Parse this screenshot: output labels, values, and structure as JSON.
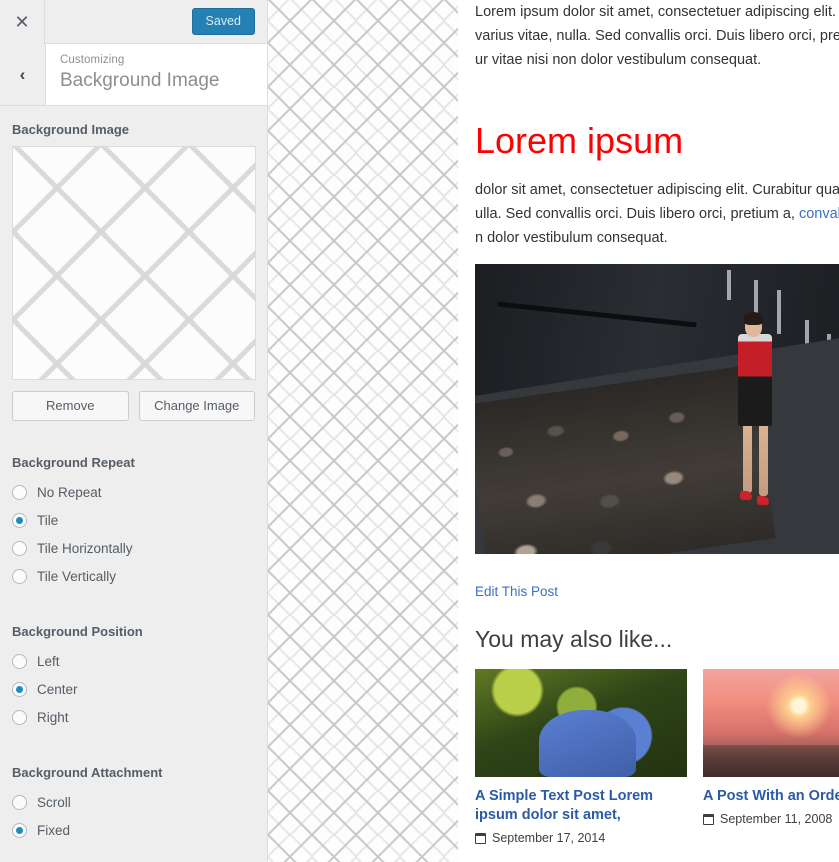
{
  "customizer": {
    "close_label": "✕",
    "saved_button": "Saved",
    "back_label": "‹",
    "subtitle": "Customizing",
    "title": "Background Image",
    "controls": {
      "background_image_label": "Background Image",
      "remove_button": "Remove",
      "change_image_button": "Change Image"
    },
    "sections": [
      {
        "title": "Background Repeat",
        "options": [
          {
            "label": "No Repeat",
            "selected": false
          },
          {
            "label": "Tile",
            "selected": true
          },
          {
            "label": "Tile Horizontally",
            "selected": false
          },
          {
            "label": "Tile Vertically",
            "selected": false
          }
        ]
      },
      {
        "title": "Background Position",
        "options": [
          {
            "label": "Left",
            "selected": false
          },
          {
            "label": "Center",
            "selected": true
          },
          {
            "label": "Right",
            "selected": false
          }
        ]
      },
      {
        "title": "Background Attachment",
        "options": [
          {
            "label": "Scroll",
            "selected": false
          },
          {
            "label": "Fixed",
            "selected": true
          }
        ]
      }
    ],
    "accent_color": "#1e8cbe",
    "saved_button_color": "#2580b3"
  },
  "preview": {
    "top_paragraph": {
      "line1": "Lorem ipsum dolor sit amet, consectetuer adipiscing elit. Cur",
      "line2": "varius vitae, nulla. Sed convallis orci. Duis libero orci, pretium",
      "line3": "ur vitae nisi non dolor vestibulum consequat."
    },
    "heading": "Lorem ipsum",
    "heading_color": "#ff0000",
    "body_paragraph": {
      "line1": "dolor sit amet, consectetuer adipiscing elit. Curabitur quam a",
      "line2_pre": "ulla. Sed convallis orci. Duis libero orci, pretium a, ",
      "line2_link": "convallis qu",
      "line3": "n dolor vestibulum consequat."
    },
    "featured_image_alt": "fashion runway show with model in red and black dress",
    "edit_link": "Edit This Post",
    "related_heading": "You may also like...",
    "link_color": "#3b6fc4",
    "related_posts": [
      {
        "title": "A Simple Text Post Lorem ipsum dolor sit amet,",
        "date": "September 17, 2014",
        "image_alt": "woman in blue dress by green foliage"
      },
      {
        "title": "A Post With an Ordered",
        "date": "September 11, 2008",
        "image_alt": "family silhouette on pier at sunset"
      }
    ]
  }
}
